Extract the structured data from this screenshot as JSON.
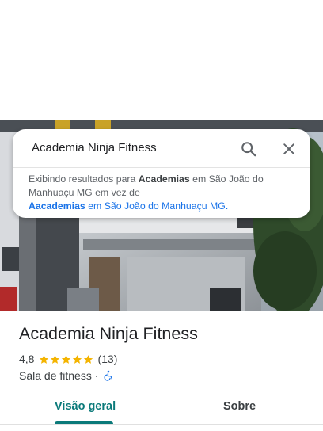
{
  "search": {
    "query": "Academia Ninja Fitness",
    "notice_prefix": "Exibindo resultados para ",
    "notice_shown_term": "Academias",
    "notice_middle": " em São João do Manhuaçu MG em vez de",
    "notice_original_term": "Aacademias",
    "notice_suffix": " em São João do Manhuaçu MG."
  },
  "place": {
    "name": "Academia Ninja Fitness",
    "rating": "4,8",
    "stars": 5,
    "review_count": "(13)",
    "category": "Sala de fitness",
    "separator": " · "
  },
  "tabs": [
    {
      "label": "Visão geral",
      "active": true
    },
    {
      "label": "Sobre",
      "active": false
    }
  ],
  "colors": {
    "accent": "#0b7a7a",
    "link": "#1a73e8",
    "star": "#f4b400",
    "accessibility_icon": "#1a73e8"
  },
  "icons": {
    "search": "search-icon",
    "close": "close-icon",
    "star": "star-icon",
    "accessibility": "wheelchair-icon"
  }
}
